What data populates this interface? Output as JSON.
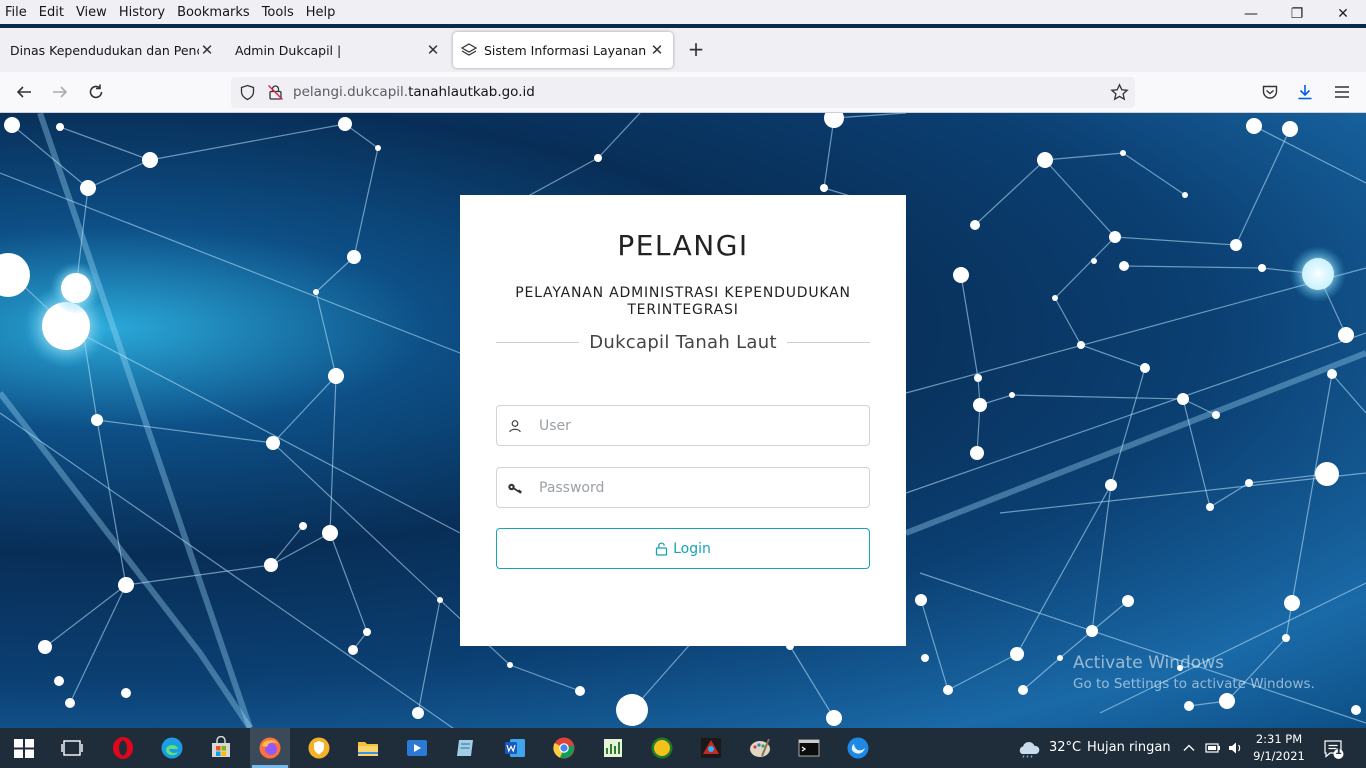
{
  "menu": [
    "File",
    "Edit",
    "View",
    "History",
    "Bookmarks",
    "Tools",
    "Help"
  ],
  "window_controls": {
    "minimize": "—",
    "restore": "❐",
    "close": "✕"
  },
  "tabs": [
    {
      "title": "Dinas Kependudukan dan Pencatatan Sipil"
    },
    {
      "title": "Admin Dukcapil |"
    },
    {
      "title": "Sistem Informasi Layanan Terintegrasi"
    }
  ],
  "new_tab": "+",
  "url": {
    "prefix": "pelangi.dukcapil.",
    "domain": "tanahlautkab.go.id"
  },
  "login": {
    "title": "PELANGI",
    "subtitle": "PELAYANAN ADMINISTRASI KEPENDUDUKAN TERINTEGRASI",
    "org": "Dukcapil Tanah Laut",
    "user_placeholder": "User",
    "password_placeholder": "Password",
    "button": "Login"
  },
  "watermark": {
    "line1": "Activate Windows",
    "line2": "Go to Settings to activate Windows."
  },
  "taskbar": {
    "weather_temp": "32°C",
    "weather_desc": "Hujan ringan",
    "time": "2:31 PM",
    "date": "9/1/2021",
    "notification_count": "1"
  },
  "colors": {
    "accent": "#17a2b8",
    "taskbar": "#1f2d3b",
    "chrome": "#f0f0f4"
  }
}
